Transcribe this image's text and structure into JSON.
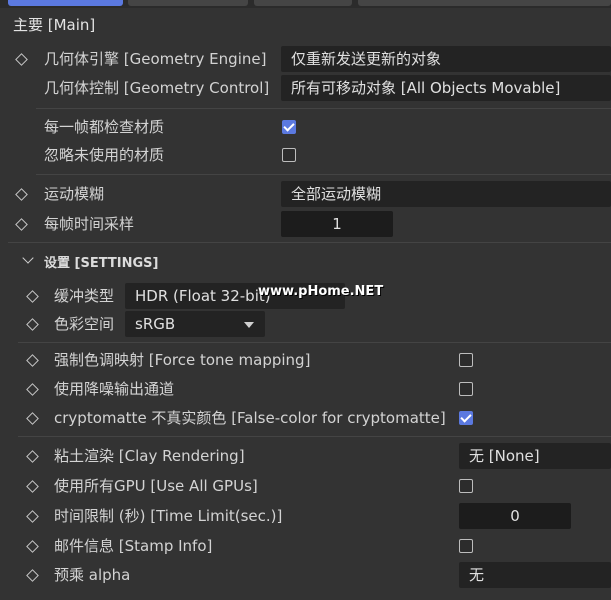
{
  "section": {
    "title": "主要 [Main]"
  },
  "geometry": {
    "engine_label": "几何体引擎 [Geometry Engine]",
    "engine_value": "仅重新发送更新的对象",
    "control_label": "几何体控制 [Geometry Control]",
    "control_value": "所有可移动对象 [All Objects Movable]"
  },
  "materials": {
    "check_each_frame_label": "每一帧都检查材质",
    "check_each_frame": true,
    "ignore_unused_label": "忽略未使用的材质",
    "ignore_unused": false
  },
  "motion": {
    "blur_label": "运动模糊",
    "blur_value": "全部运动模糊",
    "samples_label": "每帧时间采样",
    "samples_value": "1"
  },
  "settings": {
    "title": "设置 [SETTINGS]",
    "buffer_label": "缓冲类型",
    "buffer_value": "HDR (Float 32-bit)",
    "colorspace_label": "色彩空间",
    "colorspace_value": "sRGB",
    "force_tone_label": "强制色调映射 [Force tone mapping]",
    "force_tone": false,
    "denoise_label": "使用降噪输出通道",
    "denoise": false,
    "crypto_label": "cryptomatte 不真实颜色 [False-color for cryptomatte]",
    "crypto": true,
    "clay_label": "粘土渲染 [Clay Rendering]",
    "clay_value": "无 [None]",
    "all_gpus_label": "使用所有GPU [Use All GPUs]",
    "all_gpus": false,
    "time_limit_label": "时间限制 (秒) [Time Limit(sec.)]",
    "time_limit_value": "0",
    "stamp_label": "邮件信息 [Stamp Info]",
    "stamp": false,
    "premult_label": "预乘 alpha",
    "premult_value": "无"
  },
  "watermark": {
    "text": "www.pHome.NET"
  },
  "colors": {
    "accent": "#5b79e0",
    "background": "#333333",
    "field": "#232323"
  }
}
